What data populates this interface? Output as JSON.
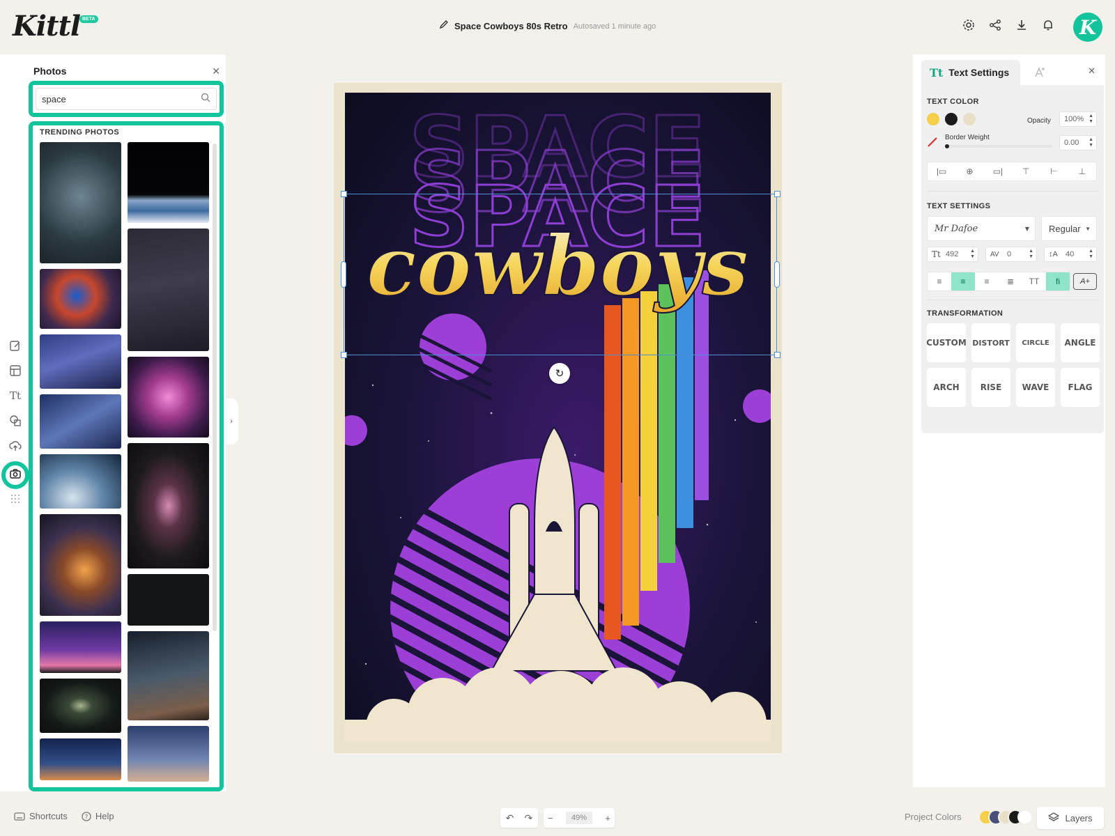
{
  "app": {
    "logo": "Kittl",
    "beta_badge": "BETA"
  },
  "document": {
    "title": "Space Cowboys 80s Retro",
    "autosave": "Autosaved 1 minute ago"
  },
  "user": {
    "avatar_letter": "K"
  },
  "photos_panel": {
    "title": "Photos",
    "search_value": "space",
    "section_label": "TRENDING PHOTOS"
  },
  "poster": {
    "headline_repeat": "SPACE",
    "script_text": "cowboys"
  },
  "text_settings": {
    "tab_label": "Text Settings",
    "text_color_label": "TEXT COLOR",
    "colors": [
      "#f6cf4a",
      "#1b1b1b",
      "#e9dfc6"
    ],
    "opacity_label": "Opacity",
    "opacity_value": "100%",
    "border_weight_label": "Border Weight",
    "border_weight_value": "0.00",
    "text_settings_label": "TEXT SETTINGS",
    "font_name": "Mr Dafoe",
    "font_weight": "Regular",
    "font_size": "492",
    "letter_spacing": "0",
    "line_height": "40",
    "case_button": "TT",
    "ligature_button": "fi",
    "transformation_label": "TRANSFORMATION",
    "transforms": [
      "CUSTOM",
      "DISTORT",
      "CIRCLE",
      "ANGLE",
      "ARCH",
      "RISE",
      "WAVE",
      "FLAG"
    ]
  },
  "bottom_bar": {
    "shortcuts": "Shortcuts",
    "help": "Help",
    "zoom": "49%",
    "project_colors": "Project Colors",
    "layers": "Layers"
  },
  "accent_color": "#12c49b"
}
